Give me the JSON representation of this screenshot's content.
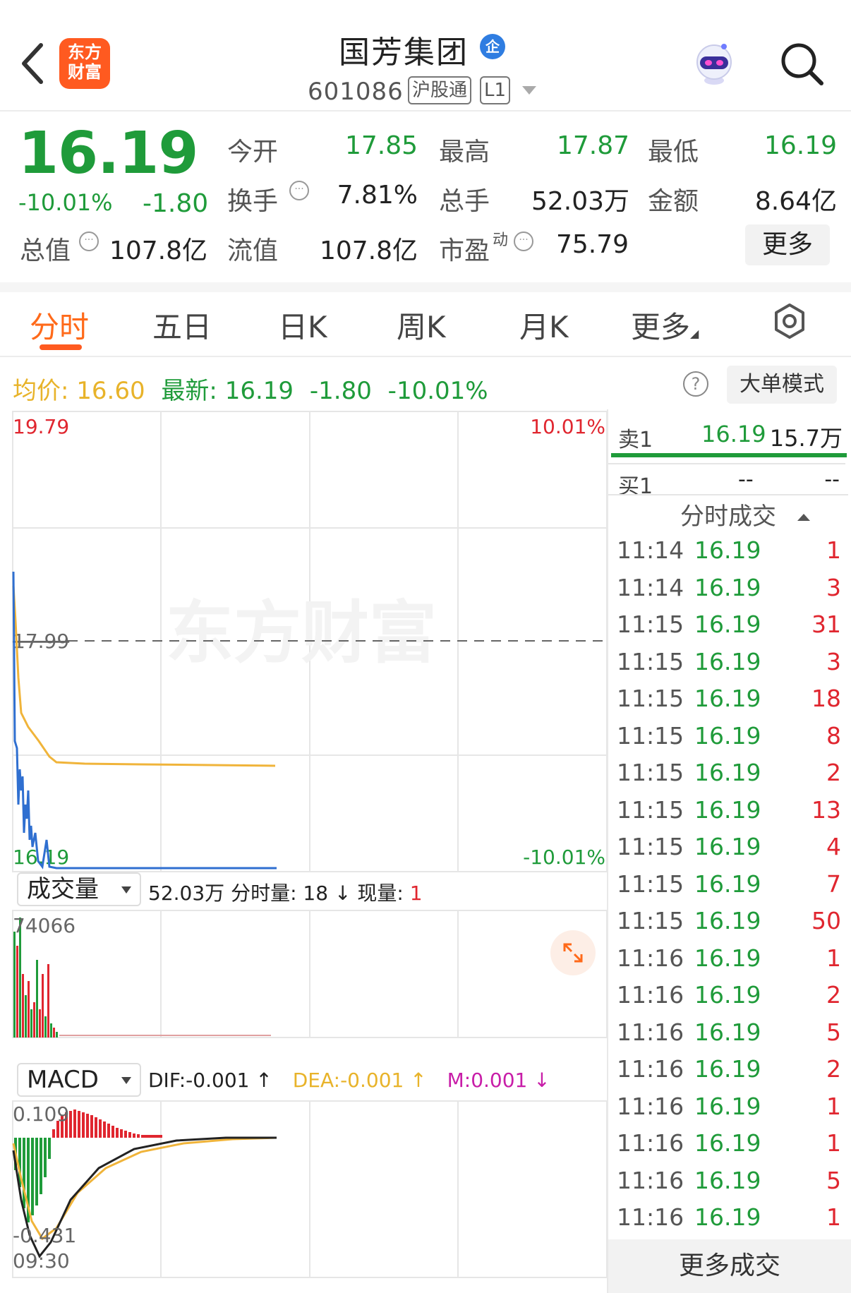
{
  "header": {
    "logo_line1": "东方",
    "logo_line2": "财富",
    "title": "国芳集团",
    "badge": "企",
    "code": "601086",
    "tag_market": "沪股通",
    "tag_level": "L1"
  },
  "quote": {
    "price": "16.19",
    "change_pct": "-10.01%",
    "change": "-1.80",
    "open_label": "今开",
    "open": "17.85",
    "high_label": "最高",
    "high": "17.87",
    "low_label": "最低",
    "low": "16.19",
    "turnover_label": "换手",
    "turnover": "7.81%",
    "volume_label": "总手",
    "volume": "52.03万",
    "amount_label": "金额",
    "amount": "8.64亿",
    "mcap_label": "总值",
    "mcap": "107.8亿",
    "float_label": "流值",
    "float": "107.8亿",
    "pe_label": "市盈",
    "pe_sup": "动",
    "pe": "75.79",
    "more": "更多"
  },
  "tabs": [
    "分时",
    "五日",
    "日K",
    "周K",
    "月K",
    "更多"
  ],
  "info_line": {
    "avg_label": "均价:",
    "avg": "16.60",
    "latest_label": "最新:",
    "latest": "16.19",
    "latest_change": "-1.80",
    "latest_pct": "-10.01%",
    "help": "?",
    "big_order": "大单模式"
  },
  "chart": {
    "price_max": "19.79",
    "price_min": "16.19",
    "pct_max": "10.01%",
    "pct_min": "-10.01%",
    "prev_close": "17.99",
    "watermark": "东方财富",
    "volume_selector": "成交量",
    "volume_total": "52.03万",
    "volume_period_label": "分时量:",
    "volume_period": "18",
    "volume_period_arrow": "↓",
    "volume_now_label": "现量:",
    "volume_now": "1",
    "volume_max": "74066",
    "macd_selector": "MACD",
    "dif": "DIF:-0.001 ↑",
    "dea": "DEA:-0.001 ↑",
    "m": "M:0.001 ↓",
    "macd_max": "0.109",
    "macd_min": "-0.431",
    "time_start": "09:30",
    "colors": {
      "up": "#e0262f",
      "down": "#1f9b3a",
      "price_line": "#2f6fd0",
      "avg_line": "#f0b43a"
    }
  },
  "chart_data": {
    "type": "line",
    "series": [],
    "ylim": [
      16.19,
      19.79
    ],
    "prev_close": 17.99
  },
  "orderbook": {
    "ask_label": "卖1",
    "ask_price": "16.19",
    "ask_vol": "15.7万",
    "bid_label": "买1",
    "bid_price": "--",
    "bid_vol": "--"
  },
  "trades": {
    "title": "分时成交",
    "rows": [
      {
        "time": "11:14",
        "price": "16.19",
        "vol": "1"
      },
      {
        "time": "11:14",
        "price": "16.19",
        "vol": "3"
      },
      {
        "time": "11:15",
        "price": "16.19",
        "vol": "31"
      },
      {
        "time": "11:15",
        "price": "16.19",
        "vol": "3"
      },
      {
        "time": "11:15",
        "price": "16.19",
        "vol": "18"
      },
      {
        "time": "11:15",
        "price": "16.19",
        "vol": "8"
      },
      {
        "time": "11:15",
        "price": "16.19",
        "vol": "2"
      },
      {
        "time": "11:15",
        "price": "16.19",
        "vol": "13"
      },
      {
        "time": "11:15",
        "price": "16.19",
        "vol": "4"
      },
      {
        "time": "11:15",
        "price": "16.19",
        "vol": "7"
      },
      {
        "time": "11:15",
        "price": "16.19",
        "vol": "50"
      },
      {
        "time": "11:16",
        "price": "16.19",
        "vol": "1"
      },
      {
        "time": "11:16",
        "price": "16.19",
        "vol": "2"
      },
      {
        "time": "11:16",
        "price": "16.19",
        "vol": "5"
      },
      {
        "time": "11:16",
        "price": "16.19",
        "vol": "2"
      },
      {
        "time": "11:16",
        "price": "16.19",
        "vol": "1"
      },
      {
        "time": "11:16",
        "price": "16.19",
        "vol": "1"
      },
      {
        "time": "11:16",
        "price": "16.19",
        "vol": "5"
      },
      {
        "time": "11:16",
        "price": "16.19",
        "vol": "1"
      }
    ],
    "more": "更多成交"
  }
}
